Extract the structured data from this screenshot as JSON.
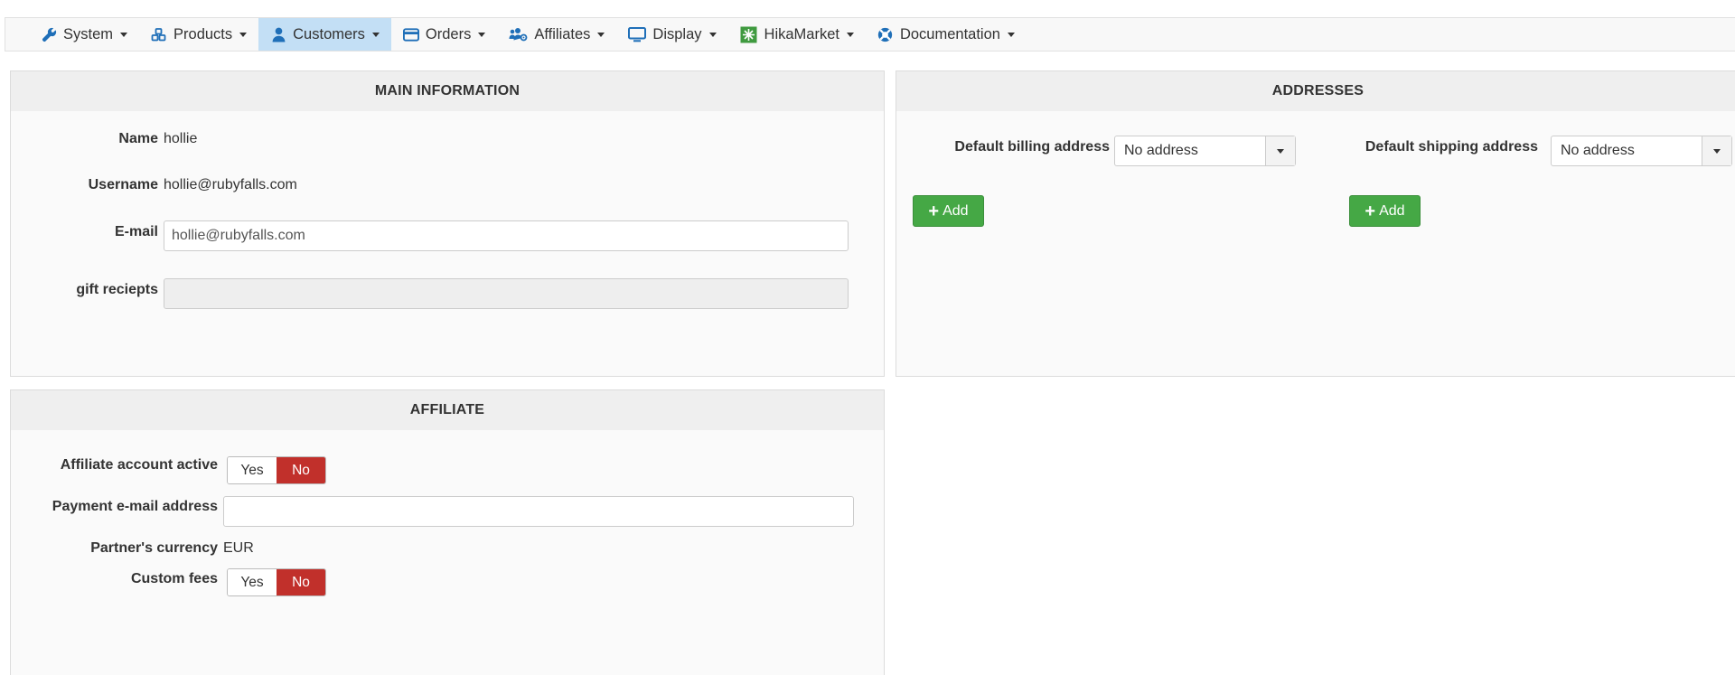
{
  "menu": [
    {
      "label": "System",
      "icon": "wrench-icon"
    },
    {
      "label": "Products",
      "icon": "cubes-icon"
    },
    {
      "label": "Customers",
      "icon": "user-icon"
    },
    {
      "label": "Orders",
      "icon": "credit-card-icon"
    },
    {
      "label": "Affiliates",
      "icon": "users-cog-icon"
    },
    {
      "label": "Display",
      "icon": "monitor-icon"
    },
    {
      "label": "HikaMarket",
      "icon": "hikamarket-icon"
    },
    {
      "label": "Documentation",
      "icon": "lifebuoy-icon"
    }
  ],
  "main_info": {
    "title": "MAIN INFORMATION",
    "name_label": "Name",
    "name_value": "hollie",
    "username_label": "Username",
    "username_value": "hollie@rubyfalls.com",
    "email_label": "E-mail",
    "email_value": "hollie@rubyfalls.com",
    "gift_label": "gift reciepts",
    "gift_value": ""
  },
  "addresses": {
    "title": "ADDRESSES",
    "billing_label": "Default billing address",
    "billing_value": "No address",
    "shipping_label": "Default shipping address",
    "shipping_value": "No address",
    "add_label": "Add"
  },
  "affiliate": {
    "title": "AFFILIATE",
    "active_label": "Affiliate account active",
    "payment_label": "Payment e-mail address",
    "payment_value": "",
    "currency_label": "Partner's currency",
    "currency_value": "EUR",
    "fees_label": "Custom fees",
    "yes": "Yes",
    "no": "No"
  },
  "colors": {
    "accent": "#1f6fb8",
    "active_menu": "#c3dff5",
    "no_on": "#c1302b",
    "add_button": "#45a845"
  }
}
